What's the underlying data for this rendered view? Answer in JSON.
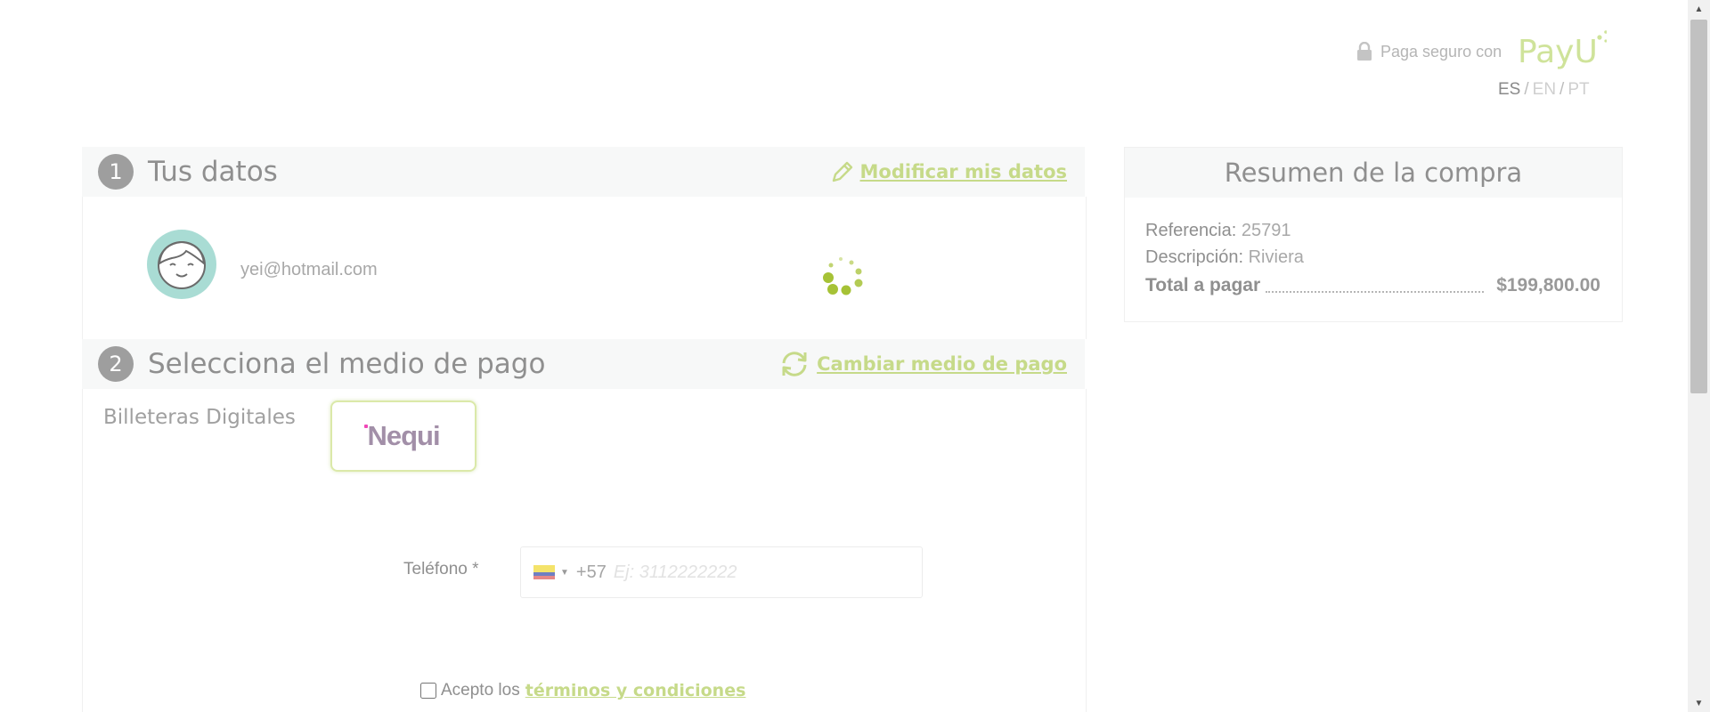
{
  "header": {
    "secure_text": "Paga seguro con",
    "brand": "PayU",
    "languages": [
      {
        "code": "ES",
        "active": true
      },
      {
        "code": "EN",
        "active": false
      },
      {
        "code": "PT",
        "active": false
      }
    ],
    "lang_separator": "/"
  },
  "section1": {
    "number": "1",
    "title": "Tus datos",
    "link_label": "Modificar mis datos",
    "link_icon": "pencil-icon",
    "email": "yei@hotmail.com"
  },
  "section2": {
    "number": "2",
    "title": "Selecciona el medio de pago",
    "link_label": "Cambiar medio de pago",
    "link_icon": "refresh-icon",
    "wallet_label": "Billeteras Digitales",
    "wallet_option": "Nequi",
    "phone_label": "Teléfono *",
    "dial_code": "+57",
    "phone_value": "",
    "phone_placeholder": "Ej: 3112222222",
    "country_flag": "colombia-flag-icon",
    "terms_prefix": "Acepto los",
    "terms_link": "términos y condiciones"
  },
  "summary": {
    "title": "Resumen de la compra",
    "reference_label": "Referencia:",
    "reference_value": "25791",
    "description_label": "Descripción:",
    "description_value": "Riviera",
    "total_label": "Total a pagar",
    "total_value": "$199,800.00"
  },
  "colors": {
    "accent": "#c6da89",
    "payu_green": "#a6c236",
    "step_circle": "#9e9e9e",
    "avatar_bg": "#a9dcd4",
    "nequi_pink": "#f048b8"
  }
}
